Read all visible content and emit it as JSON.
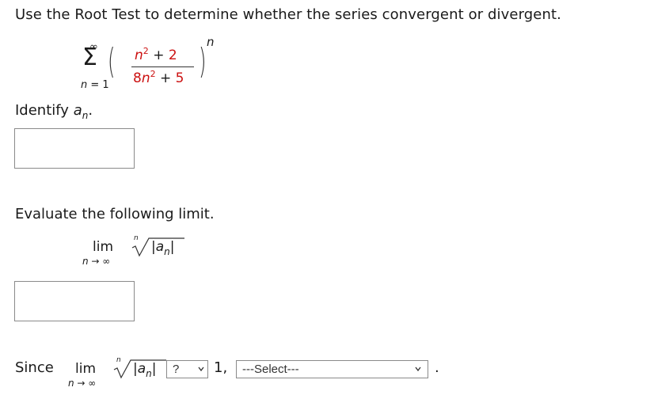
{
  "question": {
    "text": "Use the Root Test to determine whether the series convergent or divergent."
  },
  "series": {
    "upper_limit": "∞",
    "sigma": "Σ",
    "index_var": "n",
    "lower_limit": "= 1",
    "exponent": "n",
    "numerator_term": "n",
    "numerator_power": "2",
    "numerator_op": "+",
    "numerator_const": "2",
    "denominator_coef": "8",
    "denominator_term": "n",
    "denominator_power": "2",
    "denominator_op": "+",
    "denominator_const": "5"
  },
  "identify": {
    "label": "Identify",
    "var": "a",
    "sub": "n",
    "end": ".",
    "input_value": ""
  },
  "evaluate": {
    "label": "Evaluate the following limit.",
    "lim": "lim",
    "lim_sub": "n → ∞",
    "root_index": "n",
    "abs_open": "|",
    "var": "a",
    "sub": "n",
    "abs_close": "|",
    "input_value": ""
  },
  "since": {
    "label": "Since",
    "lim": "lim",
    "lim_sub": "n → ∞",
    "root_index": "n",
    "abs_open": "|",
    "var": "a",
    "sub": "n",
    "abs_close": "|",
    "comparison_select": "?",
    "comparison_value": "1,",
    "result_select": "---Select---",
    "end": "."
  }
}
